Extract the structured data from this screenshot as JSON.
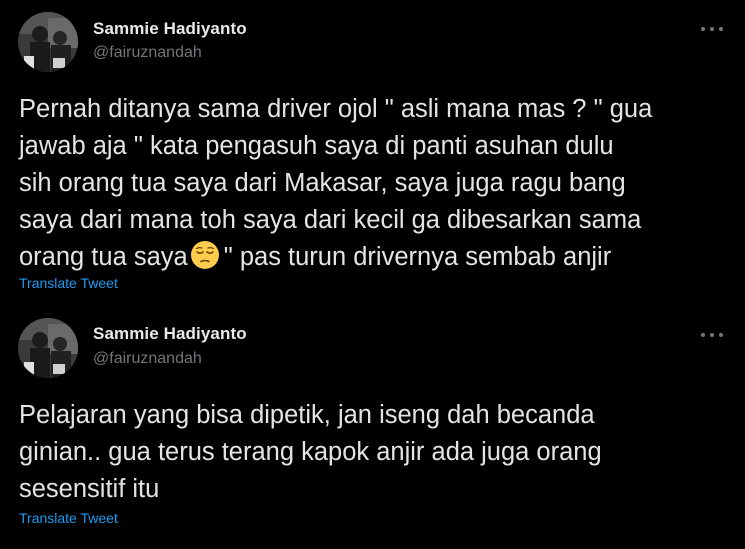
{
  "tweets": [
    {
      "author": {
        "name": "Sammie Hadiyanto",
        "handle": "@fairuznandah"
      },
      "text_before_emoji": "Pernah ditanya sama driver ojol \" asli mana mas ? \" gua\njawab aja \" kata pengasuh saya di panti asuhan dulu\nsih orang tua saya dari Makasar, saya juga ragu bang\nsaya dari mana toh saya dari kecil ga dibesarkan sama\norang tua saya",
      "emoji": "pensive-face-emoji",
      "text_after_emoji": "\" pas turun drivernya sembab anjir",
      "translate_label": "Translate Tweet"
    },
    {
      "author": {
        "name": "Sammie Hadiyanto",
        "handle": "@fairuznandah"
      },
      "text": "Pelajaran yang bisa dipetik, jan iseng dah becanda\nginian.. gua terus terang kapok anjir ada juga orang\nsesensitif itu",
      "translate_label": "Translate Tweet"
    }
  ],
  "colors": {
    "background": "#000000",
    "name": "#e7e9ea",
    "handle": "#71767b",
    "body_text": "#e4e4e4",
    "link": "#1d9bf0"
  },
  "icons": {
    "more": "more-horizontal-icon",
    "avatar": "avatar-photo"
  }
}
